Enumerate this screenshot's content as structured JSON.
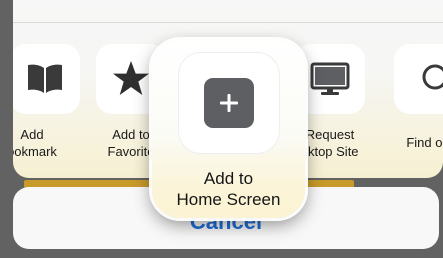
{
  "share_sheet": {
    "actions": [
      {
        "id": "add-bookmark",
        "label_line1": "Add",
        "label_line2": "ookmark",
        "icon": "book-icon"
      },
      {
        "id": "add-to-favorites",
        "label_line1": "Add to",
        "label_line2": "Favorite",
        "icon": "star-icon"
      },
      {
        "id": "request-desktop-site",
        "label_line1": "Request",
        "label_line2": "sktop Site",
        "icon": "monitor-icon"
      },
      {
        "id": "find-on-page",
        "label_line1": "Find on",
        "label_line2": "",
        "icon": "magnifier-icon"
      }
    ],
    "highlighted_action": {
      "label_line1": "Add to",
      "label_line2": "Home Screen",
      "icon": "plus-square-icon"
    },
    "cancel_label": "Cancel"
  },
  "colors": {
    "accent": "#1e6fd9",
    "icon_dark": "#3a3a3a",
    "plus_tile": "#5d5f63",
    "progress": "#c79a2a"
  }
}
